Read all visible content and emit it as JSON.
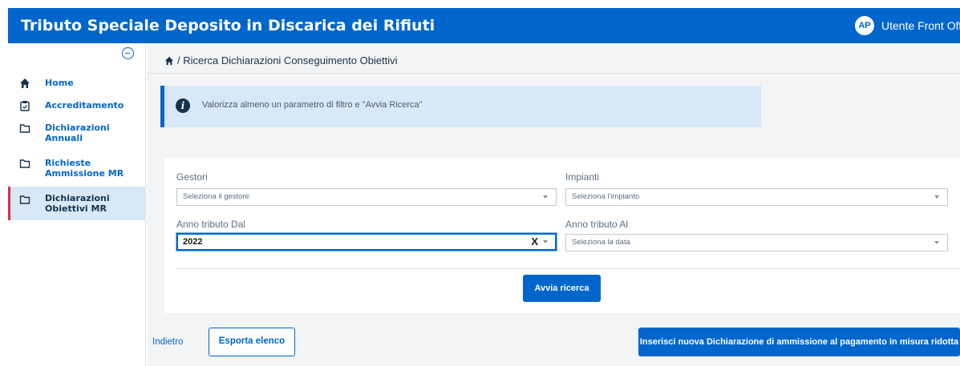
{
  "header": {
    "title": "Tributo Speciale Deposito in Discarica dei Rifiuti",
    "avatar_initials": "AP",
    "user_name": "Utente Front Office"
  },
  "sidebar": {
    "items": [
      {
        "label": "Home",
        "icon": "home-icon"
      },
      {
        "label": "Accreditamento",
        "icon": "clipboard-icon"
      },
      {
        "label": "Dichiarazioni Annuali",
        "icon": "folder-icon"
      },
      {
        "label": "Richieste Ammissione MR",
        "icon": "folder-icon"
      },
      {
        "label": "Dichiarazioni Obiettivi MR",
        "icon": "folder-icon",
        "active": true
      }
    ]
  },
  "breadcrumb": {
    "text": "/ Ricerca Dichiarazioni Conseguimento Obiettivi"
  },
  "alert": {
    "text": "Valorizza almeno un parametro di filtro e \"Avvia Ricerca\""
  },
  "filters": {
    "gestori": {
      "label": "Gestori",
      "placeholder": "Seleziona il gestore"
    },
    "impianti": {
      "label": "Impianti",
      "placeholder": "Seleziona l'impianto"
    },
    "anno_dal": {
      "label": "Anno tributo Dal",
      "value": "2022",
      "clear": "X"
    },
    "anno_al": {
      "label": "Anno tributo Al",
      "placeholder": "Seleziona la data"
    }
  },
  "actions": {
    "search_label": "Avvia ricerca",
    "back_label": "Indietro",
    "export_label": "Esporta elenco",
    "new_label": "Inserisci nuova Dichiarazione di ammissione al pagamento in misura ridotta"
  },
  "colors": {
    "primary": "#0066cc",
    "active_marker": "#d1344c",
    "alert_bg": "#d9e8f6"
  }
}
